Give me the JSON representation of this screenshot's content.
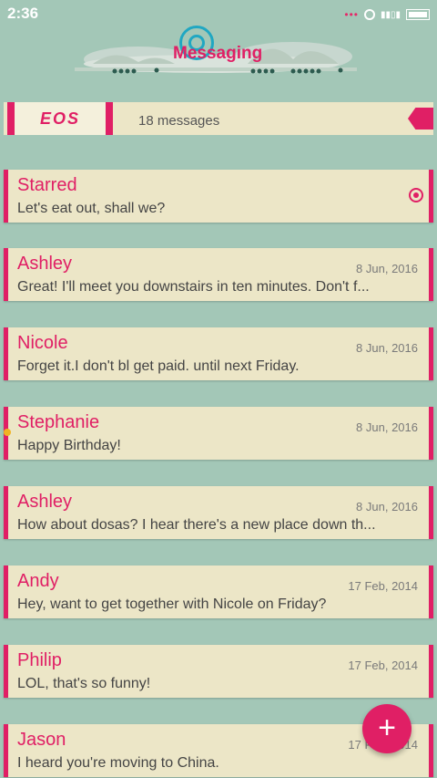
{
  "status": {
    "time": "2:36",
    "notification_dots": "•••"
  },
  "header": {
    "title": "Messaging"
  },
  "banner": {
    "logo_text": "EOS",
    "message_count": "18 messages"
  },
  "messages": [
    {
      "sender": "Starred",
      "preview": "Let's eat out, shall we?",
      "date": "",
      "icon": "starred-icon"
    },
    {
      "sender": "Ashley",
      "preview": "Great! I'll meet you downstairs in ten minutes. Don't f...",
      "date": "8 Jun, 2016"
    },
    {
      "sender": "Nicole",
      "preview": "Forget it.I don't bl get paid. until next Friday.",
      "date": "8 Jun, 2016"
    },
    {
      "sender": "Stephanie",
      "preview": "Happy Birthday!",
      "date": "8 Jun, 2016"
    },
    {
      "sender": "Ashley",
      "preview": "How about dosas? I hear there's a new place down th...",
      "date": "8 Jun, 2016"
    },
    {
      "sender": "Andy",
      "preview": "Hey, want to get together with Nicole on Friday?",
      "date": "17 Feb, 2014"
    },
    {
      "sender": "Philip",
      "preview": "LOL, that's so funny!",
      "date": "17 Feb, 2014"
    },
    {
      "sender": "Jason",
      "preview": "I heard you're moving to China.",
      "date": "17 Feb, 2014"
    }
  ],
  "fab": {
    "icon": "plus-icon",
    "glyph": "+"
  },
  "colors": {
    "accent": "#e01f65",
    "background": "#a3c7b7",
    "card": "#ece6c7"
  }
}
